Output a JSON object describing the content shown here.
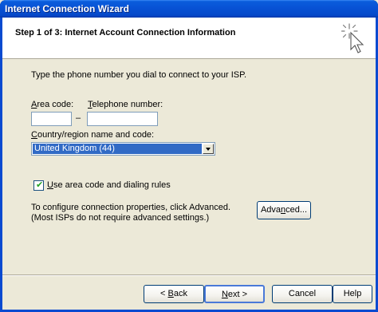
{
  "window": {
    "title": "Internet Connection Wizard"
  },
  "header": {
    "step_title": "Step 1 of 3: Internet Account Connection Information",
    "icon": "wizard-cursor-sparkle-icon"
  },
  "form": {
    "intro": "Type the phone number you dial to connect to your ISP.",
    "area_code_label_u": "A",
    "area_code_label_rest": "rea code:",
    "area_code_value": "",
    "dash": "–",
    "telephone_label_u": "T",
    "telephone_label_rest": "elephone number:",
    "telephone_value": "",
    "country_label_u": "C",
    "country_label_rest": "ountry/region name and code:",
    "country_value": "United Kingdom (44)",
    "use_rules_checked": true,
    "use_rules_label_u": "U",
    "use_rules_label_rest": "se area code and dialing rules",
    "advanced_line1": "To configure connection properties, click Advanced.",
    "advanced_line2": "(Most ISPs do not require advanced settings.)",
    "advanced_button_pre": "Adva",
    "advanced_button_u": "n",
    "advanced_button_post": "ced..."
  },
  "footer": {
    "back_pre": "< ",
    "back_u": "B",
    "back_post": "ack",
    "next_u": "N",
    "next_post": "ext >",
    "cancel": "Cancel",
    "help": "Help"
  }
}
